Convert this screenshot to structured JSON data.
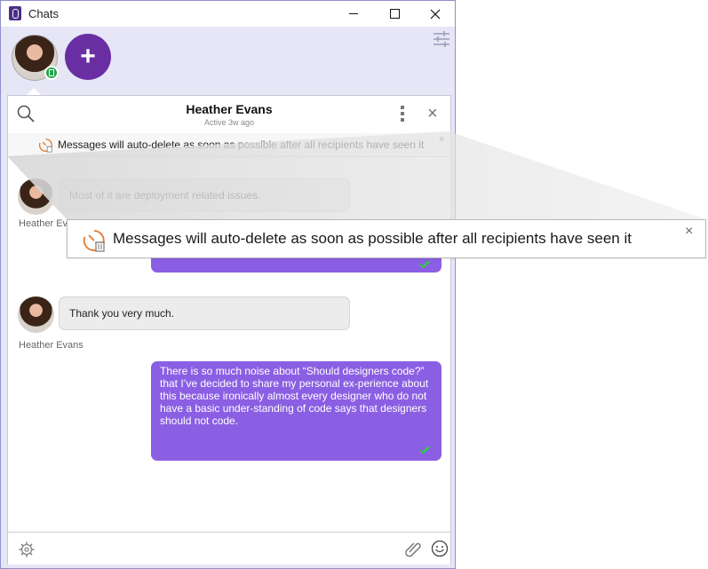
{
  "window": {
    "title": "Chats"
  },
  "chat": {
    "contact_name": "Heather Evans",
    "contact_status": "Active 3w ago",
    "banner_text": "Messages will auto-delete as soon as possible after all recipients have seen it",
    "messages": [
      {
        "direction": "in",
        "text": "Most of it are deployment related issues.",
        "sender": "Heather Evans"
      },
      {
        "direction": "out",
        "text": "",
        "status": "read"
      },
      {
        "direction": "in",
        "text": "Thank you very much.",
        "sender": "Heather Evans"
      },
      {
        "direction": "out",
        "text": "There is so much noise about “Should designers code?” that I’ve decided to share my personal ex-perience about this because ironically almost every designer who do not have a basic under-standing of code says that designers should not code.",
        "status": "read"
      }
    ]
  },
  "callout": {
    "text": "Messages will auto-delete as soon as possible after all recipients have seen it"
  },
  "icons": {
    "close": "×",
    "add": "+"
  },
  "colors": {
    "brand_purple": "#6a2ea3",
    "outgoing_bubble": "#8b5fe3",
    "window_bg": "#e6e6f7",
    "read_check": "#2ecc40",
    "presence": "#22a34a"
  }
}
